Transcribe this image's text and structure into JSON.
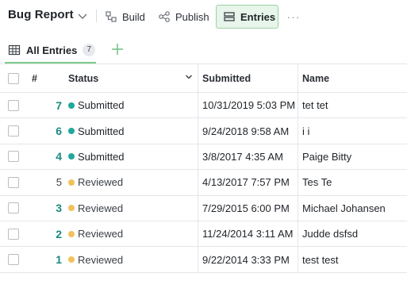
{
  "app": {
    "title": "Bug Report"
  },
  "toolbar": {
    "build_label": "Build",
    "publish_label": "Publish",
    "entries_label": "Entries",
    "more_label": "···"
  },
  "tabs": [
    {
      "label": "All Entries",
      "count": "7"
    }
  ],
  "table": {
    "headers": {
      "num": "#",
      "status": "Status",
      "submitted": "Submitted",
      "name": "Name"
    },
    "rows": [
      {
        "num": "7",
        "status": "Submitted",
        "submitted": "10/31/2019 5:03 PM",
        "name": "tet tet"
      },
      {
        "num": "6",
        "status": "Submitted",
        "submitted": "9/24/2018 9:58 AM",
        "name": "i i"
      },
      {
        "num": "4",
        "status": "Submitted",
        "submitted": "3/8/2017 4:35 AM",
        "name": "Paige Bitty"
      },
      {
        "num": "5",
        "status": "Reviewed",
        "submitted": "4/13/2017 7:57 PM",
        "name": "Tes Te"
      },
      {
        "num": "3",
        "status": "Reviewed",
        "submitted": "7/29/2015 6:00 PM",
        "name": "Michael Johansen"
      },
      {
        "num": "2",
        "status": "Reviewed",
        "submitted": "11/24/2014 3:11 AM",
        "name": "Judde dsfsd"
      },
      {
        "num": "1",
        "status": "Reviewed",
        "submitted": "9/22/2014 3:33 PM",
        "name": "test test"
      }
    ]
  },
  "colors": {
    "submitted": "#1fa89e",
    "reviewed": "#f2c15c",
    "accent": "#7ccb8c",
    "entry_number": "#1a8a82"
  }
}
